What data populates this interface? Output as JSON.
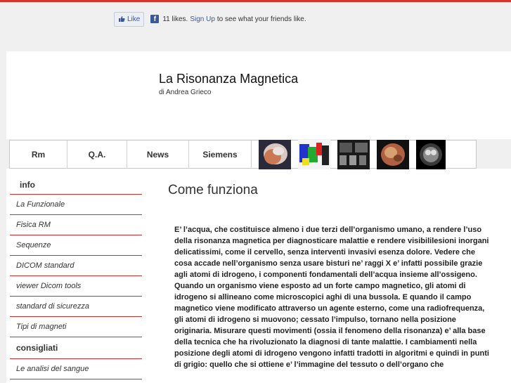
{
  "facebook": {
    "like_label": "Like",
    "likes_text": "11 likes.",
    "signup_link": "Sign Up",
    "signup_suffix": "to see what your friends like."
  },
  "header": {
    "title": "La Risonanza Magnetica",
    "subtitle": "di Andrea Grieco"
  },
  "nav": {
    "items": [
      {
        "label": "Rm"
      },
      {
        "label": "Q.A."
      },
      {
        "label": "News"
      },
      {
        "label": "Siemens"
      }
    ],
    "thumbnails": [
      "mri-brain-3d-thumbnail",
      "mri-color-scan-thumbnail",
      "mri-workstation-thumbnail",
      "mri-head-render-thumbnail",
      "mri-axial-slice-thumbnail"
    ]
  },
  "sidebar": {
    "section1_title": "info",
    "section1_items": [
      {
        "label": "La Funzionale"
      },
      {
        "label": "Fisica RM"
      },
      {
        "label": "Sequenze"
      },
      {
        "label": "DICOM standard"
      },
      {
        "label": "viewer Dicom tools"
      },
      {
        "label": "standard di sicurezza"
      },
      {
        "label": "Tipi di magneti"
      }
    ],
    "section2_title": "consigliati",
    "section2_items": [
      {
        "label": "Le analisi del sangue"
      }
    ]
  },
  "content": {
    "title": "Come funziona",
    "body": "E’ l’acqua, che costituisce almeno i due terzi dell’organismo umano, a rendere l’uso della risonanza magnetica per diagnosticare malattie e rendere visibililesioni inorgani delicatissimi, come il cervello, senza interventi invasivi esenza dolore. Vedere che cosa accade nell’organismo senza usare bisturi ne’ raggi X e’ infatti possibile grazie agli atomi di idrogeno, i componenti fondamentali dell’acqua insieme all’ossigeno. Quando un organismo viene esposto ad un forte campo magnetico, gli atomi di idrogeno si allineano come microscopici aghi di una bussola. E quando il campo magnetico viene modificato attraverso un agente esterno, come una radiofrequenza, gli atomi di idrogeno si muovono; cessato l’impulso, tornano nella posizione originaria. Misurare questi movimenti (ossia il fenomeno della risonanza) e’ alla base della tecnica che ha rivoluzionato la diagnosi di tante malattie. I cambiamenti nella posizione degli atomi di idrogeno vengono infatti tradotti in algoritmi e quindi in punti di grigio: quello che si ottiene e’ l’immagine del tessuto o dell’organo che"
  },
  "colors": {
    "accent_red": "#c9302c",
    "facebook_blue": "#3b5998"
  }
}
